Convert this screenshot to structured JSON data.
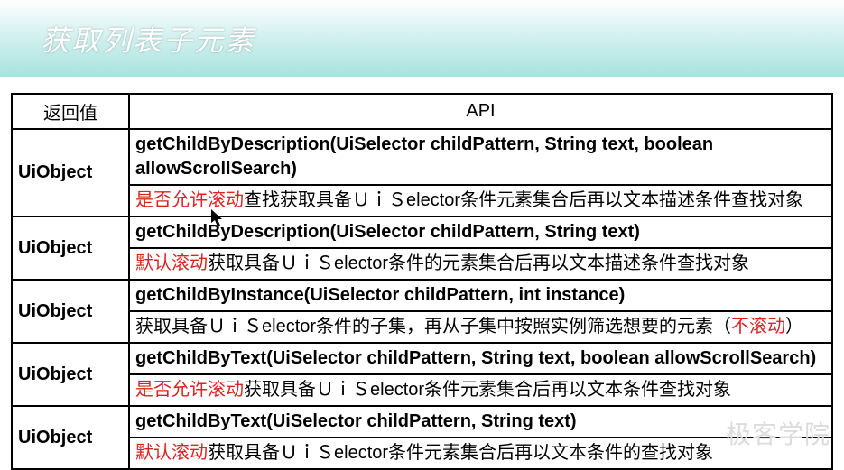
{
  "title": "获取列表子元素",
  "headers": {
    "return": "返回值",
    "api": "API"
  },
  "rows": [
    {
      "ret": "UiObject",
      "sig": "getChildByDescription(UiSelector childPattern, String text, boolean allowScrollSearch)",
      "desc_parts": [
        {
          "text": "是否允许滚动",
          "red": true
        },
        {
          "text": "查找获取具备ＵｉＳelector条件元素集合后再以文本描述条件查找对象",
          "red": false
        }
      ]
    },
    {
      "ret": "UiObject",
      "sig": "getChildByDescription(UiSelector childPattern, String text)",
      "desc_parts": [
        {
          "text": "默认滚动",
          "red": true
        },
        {
          "text": "获取具备ＵｉＳelector条件的元素集合后再以文本描述条件查找对象",
          "red": false
        }
      ]
    },
    {
      "ret": "UiObject",
      "sig": "getChildByInstance(UiSelector childPattern, int instance)",
      "desc_parts": [
        {
          "text": "获取具备ＵｉＳelector条件的子集，再从子集中按照实例筛选想要的元素（",
          "red": false
        },
        {
          "text": "不滚动",
          "red": true
        },
        {
          "text": "）",
          "red": false
        }
      ]
    },
    {
      "ret": "UiObject",
      "sig": "getChildByText(UiSelector childPattern, String text, boolean allowScrollSearch)",
      "desc_parts": [
        {
          "text": "是否允许滚动",
          "red": true
        },
        {
          "text": "获取具备ＵｉＳelector条件元素集合后再以文本条件查找对象",
          "red": false
        }
      ]
    },
    {
      "ret": "UiObject",
      "sig": "getChildByText(UiSelector childPattern, String text)",
      "desc_parts": [
        {
          "text": "默认滚动",
          "red": true
        },
        {
          "text": "获取具备ＵｉＳelector条件元素集合后再以文本条件的查找对象",
          "red": false
        }
      ]
    }
  ],
  "watermark": "极客学院"
}
